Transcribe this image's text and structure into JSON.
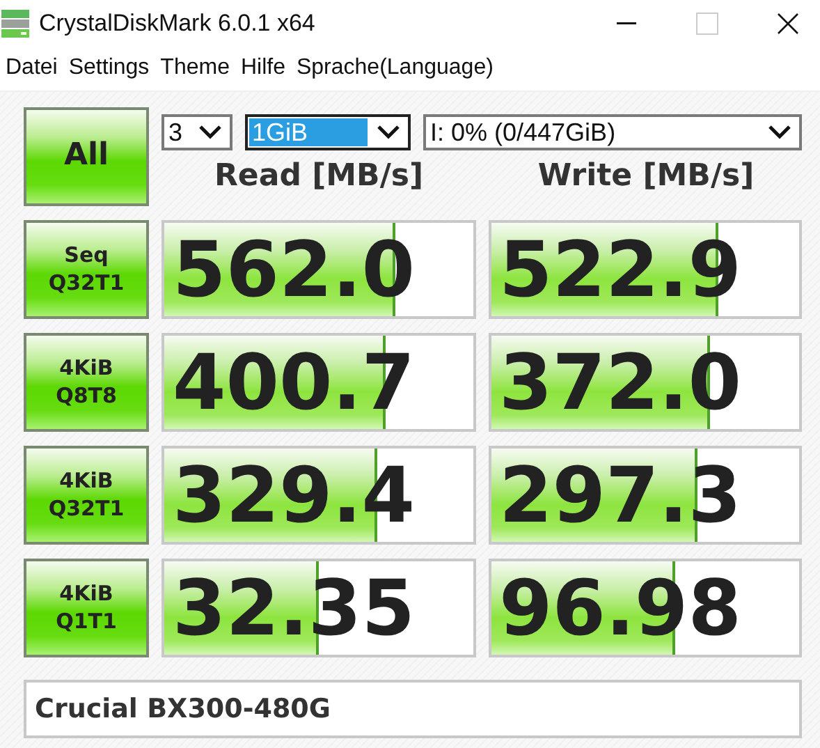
{
  "window": {
    "title": "CrystalDiskMark 6.0.1 x64"
  },
  "menu": [
    "Datei",
    "Settings",
    "Theme",
    "Hilfe",
    "Sprache(Language)"
  ],
  "all_button": "All",
  "settings": [
    {
      "value": "3",
      "focused": false
    },
    {
      "value": "1GiB",
      "focused": true
    },
    {
      "value": "I: 0% (0/447GiB)",
      "focused": false
    }
  ],
  "headers": [
    "Read [MB/s]",
    "Write [MB/s]"
  ],
  "tests": [
    {
      "lines": [
        "Seq",
        "Q32T1"
      ],
      "read": {
        "value": "562.0",
        "level": 0.74
      },
      "write": {
        "value": "522.9",
        "level": 0.73
      }
    },
    {
      "lines": [
        "4KiB",
        "Q8T8"
      ],
      "read": {
        "value": "400.7",
        "level": 0.71
      },
      "write": {
        "value": "372.0",
        "level": 0.7
      }
    },
    {
      "lines": [
        "4KiB",
        "Q32T1"
      ],
      "read": {
        "value": "329.4",
        "level": 0.68
      },
      "write": {
        "value": "297.3",
        "level": 0.66
      }
    },
    {
      "lines": [
        "4KiB",
        "Q1T1"
      ],
      "read": {
        "value": "32.35",
        "level": 0.49
      },
      "write": {
        "value": "96.98",
        "level": 0.59
      }
    }
  ],
  "comment": "Crucial BX300-480G"
}
